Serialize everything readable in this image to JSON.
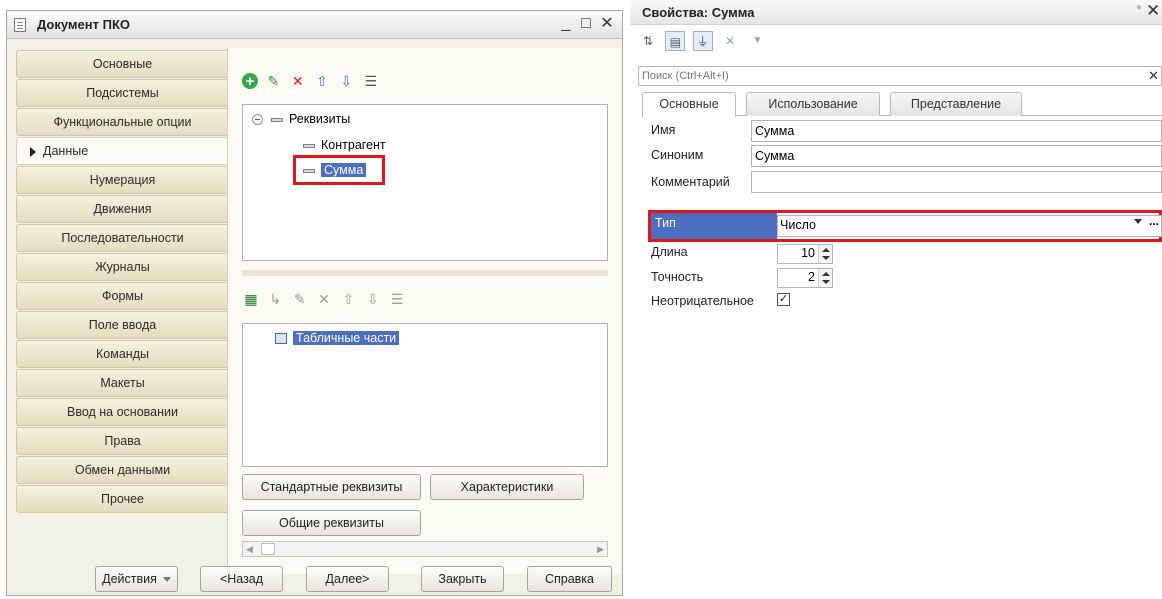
{
  "window": {
    "title": "Документ ПКО",
    "min_icon": "minimize-icon",
    "max_icon": "maximize-icon",
    "close_icon": "close-icon",
    "min_glyph": "_",
    "max_glyph": "□",
    "close_glyph": "✕"
  },
  "nav": {
    "items": [
      {
        "label": "Основные",
        "active": false
      },
      {
        "label": "Подсистемы",
        "active": false
      },
      {
        "label": "Функциональные опции",
        "active": false
      },
      {
        "label": "Данные",
        "active": true
      },
      {
        "label": "Нумерация",
        "active": false
      },
      {
        "label": "Движения",
        "active": false
      },
      {
        "label": "Последовательности",
        "active": false
      },
      {
        "label": "Журналы",
        "active": false
      },
      {
        "label": "Формы",
        "active": false
      },
      {
        "label": "Поле ввода",
        "active": false
      },
      {
        "label": "Команды",
        "active": false
      },
      {
        "label": "Макеты",
        "active": false
      },
      {
        "label": "Ввод на основании",
        "active": false
      },
      {
        "label": "Права",
        "active": false
      },
      {
        "label": "Обмен данными",
        "active": false
      },
      {
        "label": "Прочее",
        "active": false
      }
    ]
  },
  "attributes_tree": {
    "root": "Реквизиты",
    "items": [
      "Контрагент",
      "Сумма"
    ],
    "selected": "Сумма"
  },
  "tabular_tree": {
    "root": "Табличные части"
  },
  "buttons": {
    "standard_attributes": "Стандартные реквизиты",
    "characteristics": "Характеристики",
    "common_attributes": "Общие реквизиты"
  },
  "footer": {
    "actions": "Действия",
    "back": "<Назад",
    "next": "Далее>",
    "close": "Закрыть",
    "help": "Справка"
  },
  "properties": {
    "title": "Свойства: Сумма",
    "search_placeholder": "Поиск (Ctrl+Alt+I)",
    "tabs": [
      "Основные",
      "Использование",
      "Представление"
    ],
    "active_tab": "Основные",
    "name_label": "Имя",
    "name_value": "Сумма",
    "synonym_label": "Синоним",
    "synonym_value": "Сумма",
    "comment_label": "Комментарий",
    "comment_value": "",
    "type_label": "Тип",
    "type_value": "Число",
    "length_label": "Длина",
    "length_value": "10",
    "precision_label": "Точность",
    "precision_value": "2",
    "nonnegative_label": "Неотрицательное",
    "nonnegative_checked": true,
    "highlight_color": "#e0171f",
    "selection_color": "#4b6fbe"
  }
}
